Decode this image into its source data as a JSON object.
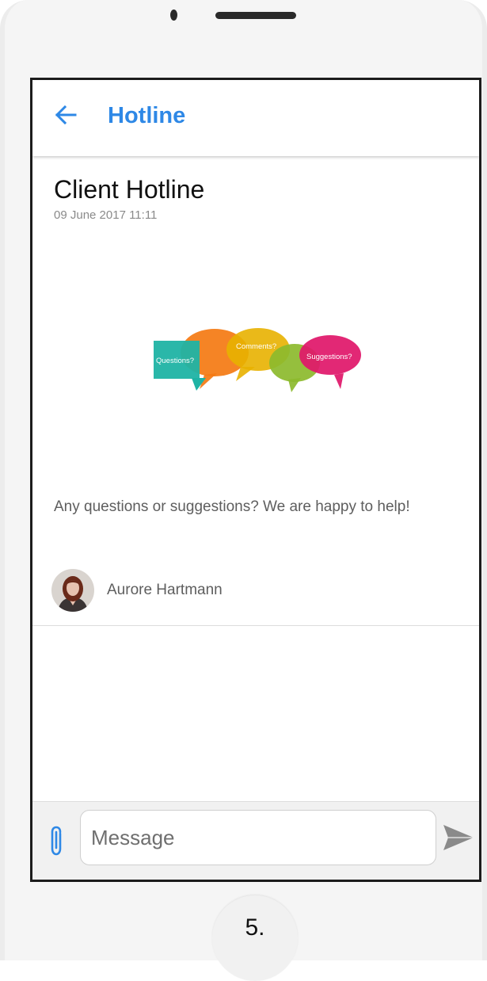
{
  "app_bar": {
    "back_icon": "arrow-left-icon",
    "title": "Hotline"
  },
  "post": {
    "title": "Client Hotline",
    "date": "09 June 2017 11:11",
    "illustration": {
      "bubbles": [
        "Questions?",
        "Comments?",
        "Suggestions?"
      ]
    },
    "body": "Any questions or suggestions? We are happy to help!",
    "author": {
      "name": "Aurore Hartmann"
    }
  },
  "composer": {
    "attach_icon": "paperclip-icon",
    "placeholder": "Message",
    "value": "",
    "send_icon": "send-icon"
  },
  "device": {
    "home_label": "5."
  },
  "colors": {
    "accent": "#2e88e6",
    "bubble_teal": "#1fb3a4",
    "bubble_orange": "#f47a12",
    "bubble_yellow": "#e8b100",
    "bubble_green": "#8cba2c",
    "bubble_pink": "#e0186b"
  }
}
